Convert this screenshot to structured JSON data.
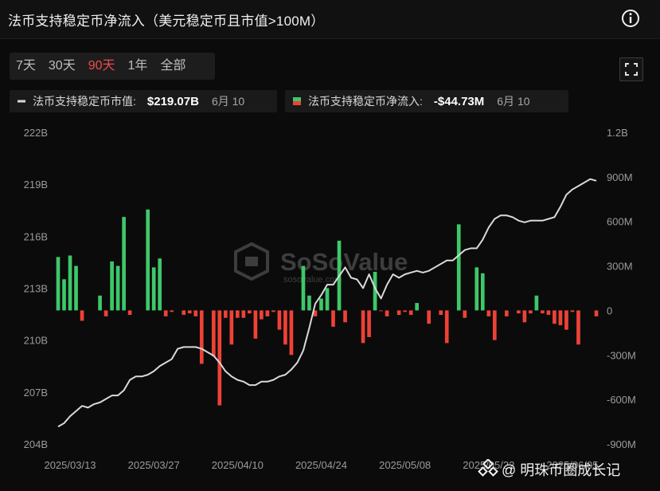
{
  "header": {
    "title": "法币支持稳定币净流入（美元稳定币且市值>100M）",
    "info_icon": "info-circle-icon"
  },
  "range_tabs": [
    {
      "label": "7天",
      "active": false
    },
    {
      "label": "30天",
      "active": false
    },
    {
      "label": "90天",
      "active": true
    },
    {
      "label": "1年",
      "active": false
    },
    {
      "label": "全部",
      "active": false
    }
  ],
  "fullscreen_icon": "fullscreen-icon",
  "legend": {
    "market_cap": {
      "label": "法币支持稳定币市值:",
      "value": "$219.07B",
      "date": "6月 10"
    },
    "net_inflow": {
      "label": "法币支持稳定币净流入:",
      "value": "-$44.73M",
      "date": "6月 10"
    }
  },
  "colors": {
    "background": "#0b0b0b",
    "positive_bar": "#3ec86a",
    "negative_bar": "#ee4236",
    "line": "#d9d9d9",
    "active_tab": "#f04b4b"
  },
  "watermark": {
    "chart_logo_text": "SoSoValue",
    "chart_logo_sub": "sosovalue.com",
    "author": "@ 明珠币圈成长记",
    "author_icon": "platform-logo-icon"
  },
  "chart_data": {
    "type": "bar+line",
    "title": "法币支持稳定币净流入（美元稳定币且市值>100M）",
    "x_tick_labels": [
      "2025/03/13",
      "2025/03/27",
      "2025/04/10",
      "2025/04/24",
      "2025/05/08",
      "2025/05/22",
      "2025/06/05"
    ],
    "y_left": {
      "ticks": [
        "204B",
        "207B",
        "210B",
        "213B",
        "216B",
        "219B",
        "222B"
      ],
      "tick_values": [
        204,
        207,
        210,
        213,
        216,
        219,
        222
      ],
      "ylim": [
        204,
        222
      ],
      "unit": "B"
    },
    "y_right": {
      "ticks": [
        "-900M",
        "-600M",
        "-300M",
        "0",
        "300M",
        "600M",
        "900M",
        "1.2B"
      ],
      "tick_values": [
        -900,
        -600,
        -300,
        0,
        300,
        600,
        900,
        1200
      ],
      "ylim": [
        -900,
        1200
      ],
      "unit": "M"
    },
    "start_date": "2025-03-11",
    "series": [
      {
        "name": "法币支持稳定币市值",
        "axis": "left",
        "type": "line",
        "values": [
          205.0,
          205.2,
          205.6,
          205.9,
          206.2,
          206.1,
          206.3,
          206.4,
          206.6,
          206.8,
          206.8,
          207.1,
          207.7,
          207.9,
          207.9,
          208.0,
          208.2,
          208.5,
          208.7,
          208.9,
          209.5,
          209.6,
          209.6,
          209.6,
          209.5,
          209.3,
          209.1,
          208.7,
          208.2,
          207.9,
          207.7,
          207.6,
          207.4,
          207.4,
          207.6,
          207.6,
          207.7,
          207.9,
          208.0,
          208.3,
          208.7,
          209.4,
          210.7,
          212.1,
          212.6,
          213.2,
          213.2,
          213.7,
          214.2,
          213.6,
          213.5,
          213.0,
          213.8,
          213.0,
          212.4,
          213.2,
          213.8,
          213.6,
          213.8,
          213.9,
          214.0,
          213.9,
          214.0,
          214.2,
          214.4,
          214.6,
          214.6,
          214.9,
          215.2,
          215.3,
          215.3,
          215.8,
          216.5,
          217.0,
          217.2,
          217.2,
          217.1,
          216.9,
          216.8,
          216.9,
          216.9,
          216.9,
          217.0,
          217.1,
          217.7,
          218.4,
          218.7,
          218.9,
          219.1,
          219.3,
          219.2
        ]
      },
      {
        "name": "法币支持稳定币净流入",
        "axis": "right",
        "type": "bar",
        "values": [
          360,
          210,
          370,
          300,
          -70,
          0,
          0,
          100,
          -40,
          330,
          300,
          630,
          -30,
          0,
          0,
          680,
          290,
          350,
          -40,
          -10,
          0,
          -30,
          -20,
          -40,
          -360,
          0,
          -310,
          -640,
          -50,
          -230,
          -50,
          -50,
          -20,
          -190,
          -60,
          -40,
          -10,
          -130,
          -230,
          -300,
          0,
          300,
          100,
          -40,
          80,
          150,
          -110,
          470,
          -80,
          0,
          0,
          -220,
          -180,
          260,
          -5,
          -40,
          0,
          -30,
          -10,
          -30,
          50,
          0,
          -90,
          0,
          -30,
          -220,
          0,
          580,
          -50,
          0,
          290,
          250,
          -40,
          -200,
          0,
          -40,
          0,
          -20,
          -80,
          -20,
          100,
          -20,
          -30,
          -90,
          -100,
          -130,
          -10,
          -230,
          0,
          0,
          -40
        ]
      }
    ],
    "grid": false,
    "legend_position": "top-left"
  }
}
